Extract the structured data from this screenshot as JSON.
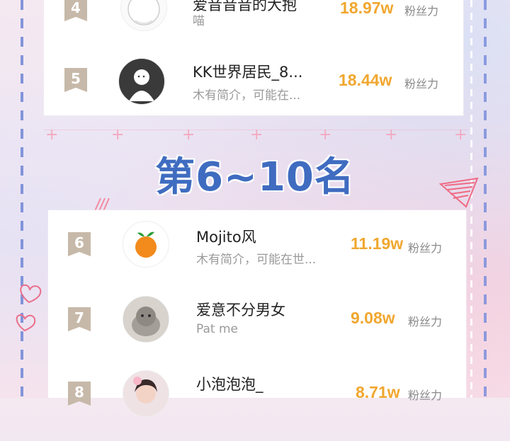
{
  "section_title": "第6~10名",
  "fans_unit_label": "粉丝力",
  "rows": [
    {
      "rank": "4",
      "name": "爱音音音的大抱",
      "bio": "喵",
      "fans": "18.97w"
    },
    {
      "rank": "5",
      "name": "KK世界居民_8...",
      "bio": "木有简介，可能在...",
      "fans": "18.44w"
    },
    {
      "rank": "6",
      "name": "Mojito风",
      "bio": "木有简介，可能在世...",
      "fans": "11.19w"
    },
    {
      "rank": "7",
      "name": "爱意不分男女",
      "bio": "Pat me",
      "fans": "9.08w"
    },
    {
      "rank": "8",
      "name": "小泡泡泡_",
      "bio": "",
      "fans": "8.71w"
    }
  ],
  "colors": {
    "fans_orange": "#f0a72f",
    "rank_badge": "#c7b9a9",
    "title_blue": "#3f6cc0",
    "dash_blue": "#6f86d6"
  }
}
